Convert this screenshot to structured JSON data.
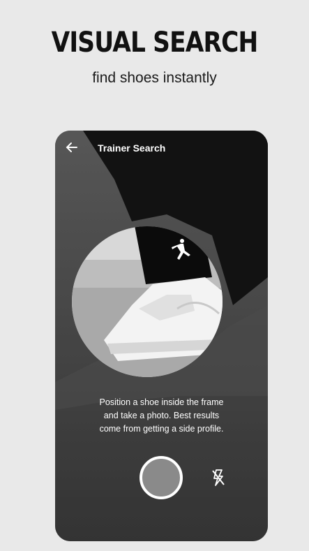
{
  "promo": {
    "headline": "VISUAL SEARCH",
    "subheadline": "find shoes instantly"
  },
  "screen": {
    "title": "Trainer Search",
    "instructions": [
      "Position a shoe inside the frame",
      "and take a photo. Best results",
      "come from getting a side profile."
    ],
    "icons": {
      "back": "back-arrow-icon",
      "shutter": "shutter-button",
      "flash": "flash-off-icon",
      "logo": "jumpman-logo"
    }
  }
}
